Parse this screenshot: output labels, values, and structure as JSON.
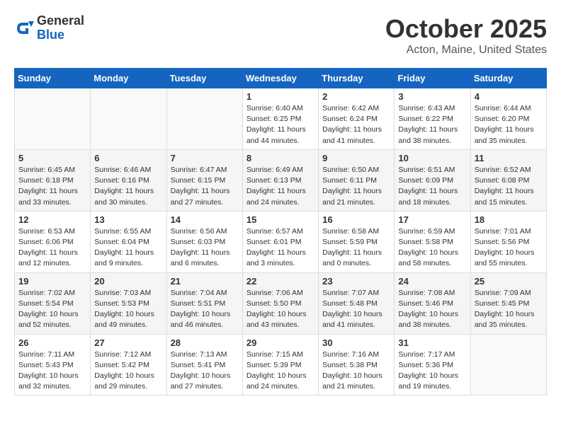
{
  "header": {
    "logo_general": "General",
    "logo_blue": "Blue",
    "month_title": "October 2025",
    "location": "Acton, Maine, United States"
  },
  "days_of_week": [
    "Sunday",
    "Monday",
    "Tuesday",
    "Wednesday",
    "Thursday",
    "Friday",
    "Saturday"
  ],
  "weeks": [
    [
      {
        "num": "",
        "info": ""
      },
      {
        "num": "",
        "info": ""
      },
      {
        "num": "",
        "info": ""
      },
      {
        "num": "1",
        "info": "Sunrise: 6:40 AM\nSunset: 6:25 PM\nDaylight: 11 hours and 44 minutes."
      },
      {
        "num": "2",
        "info": "Sunrise: 6:42 AM\nSunset: 6:24 PM\nDaylight: 11 hours and 41 minutes."
      },
      {
        "num": "3",
        "info": "Sunrise: 6:43 AM\nSunset: 6:22 PM\nDaylight: 11 hours and 38 minutes."
      },
      {
        "num": "4",
        "info": "Sunrise: 6:44 AM\nSunset: 6:20 PM\nDaylight: 11 hours and 35 minutes."
      }
    ],
    [
      {
        "num": "5",
        "info": "Sunrise: 6:45 AM\nSunset: 6:18 PM\nDaylight: 11 hours and 33 minutes."
      },
      {
        "num": "6",
        "info": "Sunrise: 6:46 AM\nSunset: 6:16 PM\nDaylight: 11 hours and 30 minutes."
      },
      {
        "num": "7",
        "info": "Sunrise: 6:47 AM\nSunset: 6:15 PM\nDaylight: 11 hours and 27 minutes."
      },
      {
        "num": "8",
        "info": "Sunrise: 6:49 AM\nSunset: 6:13 PM\nDaylight: 11 hours and 24 minutes."
      },
      {
        "num": "9",
        "info": "Sunrise: 6:50 AM\nSunset: 6:11 PM\nDaylight: 11 hours and 21 minutes."
      },
      {
        "num": "10",
        "info": "Sunrise: 6:51 AM\nSunset: 6:09 PM\nDaylight: 11 hours and 18 minutes."
      },
      {
        "num": "11",
        "info": "Sunrise: 6:52 AM\nSunset: 6:08 PM\nDaylight: 11 hours and 15 minutes."
      }
    ],
    [
      {
        "num": "12",
        "info": "Sunrise: 6:53 AM\nSunset: 6:06 PM\nDaylight: 11 hours and 12 minutes."
      },
      {
        "num": "13",
        "info": "Sunrise: 6:55 AM\nSunset: 6:04 PM\nDaylight: 11 hours and 9 minutes."
      },
      {
        "num": "14",
        "info": "Sunrise: 6:56 AM\nSunset: 6:03 PM\nDaylight: 11 hours and 6 minutes."
      },
      {
        "num": "15",
        "info": "Sunrise: 6:57 AM\nSunset: 6:01 PM\nDaylight: 11 hours and 3 minutes."
      },
      {
        "num": "16",
        "info": "Sunrise: 6:58 AM\nSunset: 5:59 PM\nDaylight: 11 hours and 0 minutes."
      },
      {
        "num": "17",
        "info": "Sunrise: 6:59 AM\nSunset: 5:58 PM\nDaylight: 10 hours and 58 minutes."
      },
      {
        "num": "18",
        "info": "Sunrise: 7:01 AM\nSunset: 5:56 PM\nDaylight: 10 hours and 55 minutes."
      }
    ],
    [
      {
        "num": "19",
        "info": "Sunrise: 7:02 AM\nSunset: 5:54 PM\nDaylight: 10 hours and 52 minutes."
      },
      {
        "num": "20",
        "info": "Sunrise: 7:03 AM\nSunset: 5:53 PM\nDaylight: 10 hours and 49 minutes."
      },
      {
        "num": "21",
        "info": "Sunrise: 7:04 AM\nSunset: 5:51 PM\nDaylight: 10 hours and 46 minutes."
      },
      {
        "num": "22",
        "info": "Sunrise: 7:06 AM\nSunset: 5:50 PM\nDaylight: 10 hours and 43 minutes."
      },
      {
        "num": "23",
        "info": "Sunrise: 7:07 AM\nSunset: 5:48 PM\nDaylight: 10 hours and 41 minutes."
      },
      {
        "num": "24",
        "info": "Sunrise: 7:08 AM\nSunset: 5:46 PM\nDaylight: 10 hours and 38 minutes."
      },
      {
        "num": "25",
        "info": "Sunrise: 7:09 AM\nSunset: 5:45 PM\nDaylight: 10 hours and 35 minutes."
      }
    ],
    [
      {
        "num": "26",
        "info": "Sunrise: 7:11 AM\nSunset: 5:43 PM\nDaylight: 10 hours and 32 minutes."
      },
      {
        "num": "27",
        "info": "Sunrise: 7:12 AM\nSunset: 5:42 PM\nDaylight: 10 hours and 29 minutes."
      },
      {
        "num": "28",
        "info": "Sunrise: 7:13 AM\nSunset: 5:41 PM\nDaylight: 10 hours and 27 minutes."
      },
      {
        "num": "29",
        "info": "Sunrise: 7:15 AM\nSunset: 5:39 PM\nDaylight: 10 hours and 24 minutes."
      },
      {
        "num": "30",
        "info": "Sunrise: 7:16 AM\nSunset: 5:38 PM\nDaylight: 10 hours and 21 minutes."
      },
      {
        "num": "31",
        "info": "Sunrise: 7:17 AM\nSunset: 5:36 PM\nDaylight: 10 hours and 19 minutes."
      },
      {
        "num": "",
        "info": ""
      }
    ]
  ]
}
